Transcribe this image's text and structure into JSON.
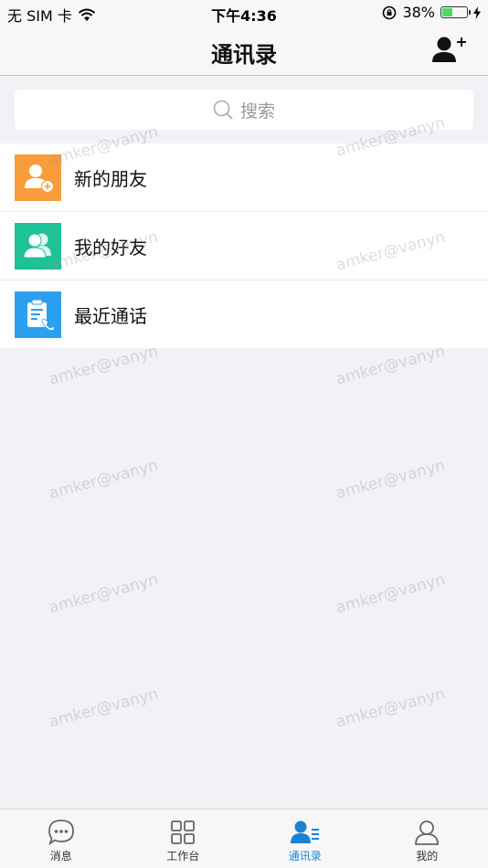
{
  "status_bar": {
    "carrier": "无 SIM 卡",
    "time": "下午4:36",
    "battery": "38%",
    "battery_level": 0.38
  },
  "nav": {
    "title": "通讯录",
    "add_icon": "add-contact-icon"
  },
  "search": {
    "placeholder": "搜索"
  },
  "contacts_menu": [
    {
      "label": "新的朋友",
      "icon": "new-friend-icon",
      "color": "#f99c3a"
    },
    {
      "label": "我的好友",
      "icon": "my-friends-icon",
      "color": "#1fc196"
    },
    {
      "label": "最近通话",
      "icon": "recent-calls-icon",
      "color": "#2d9ff0"
    }
  ],
  "watermark": "amker@vanyn",
  "tabs": [
    {
      "label": "消息",
      "icon": "message-icon"
    },
    {
      "label": "工作台",
      "icon": "workbench-icon"
    },
    {
      "label": "通讯录",
      "icon": "contacts-icon",
      "active": true
    },
    {
      "label": "我的",
      "icon": "profile-icon"
    }
  ],
  "colors": {
    "accent": "#1b82d2",
    "background": "#f1f1f6"
  }
}
